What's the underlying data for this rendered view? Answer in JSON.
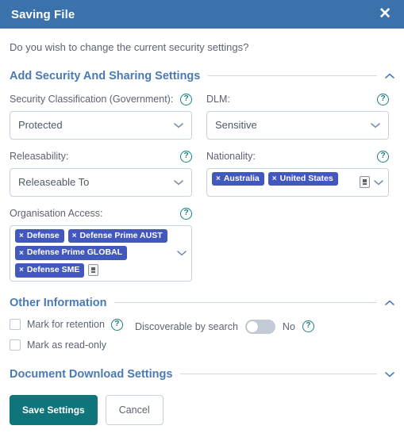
{
  "window": {
    "title": "Saving File",
    "close_icon": "close-icon"
  },
  "prompt": "Do you wish to change the current security settings?",
  "sections": {
    "security": {
      "title": "Add Security And Sharing Settings",
      "collapse_state": "expanded"
    },
    "other": {
      "title": "Other Information",
      "collapse_state": "expanded"
    },
    "download": {
      "title": "Document Download Settings",
      "collapse_state": "collapsed"
    }
  },
  "fields": {
    "security_classification": {
      "label": "Security Classification (Government):",
      "value": "Protected",
      "help": "?"
    },
    "dlm": {
      "label": "DLM:",
      "value": "Sensitive",
      "help": "?"
    },
    "releasability": {
      "label": "Releasability:",
      "value": "Releaseable To",
      "help": "?"
    },
    "nationality": {
      "label": "Nationality:",
      "help": "?",
      "tags": [
        "Australia",
        "United States"
      ],
      "remove_glyph": "×"
    },
    "organisation_access": {
      "label": "Organisation Access:",
      "help": "?",
      "tags": [
        "Defense",
        "Defense Prime AUST",
        "Defense Prime GLOBAL",
        "Defense SME"
      ],
      "remove_glyph": "×"
    }
  },
  "other_information": {
    "mark_for_retention": {
      "label": "Mark for retention",
      "checked": false,
      "help": "?"
    },
    "mark_as_read_only": {
      "label": "Mark as read-only",
      "checked": false
    },
    "discoverable_by_search": {
      "label": "Discoverable by search",
      "state": "No",
      "checked": false,
      "help": "?"
    }
  },
  "buttons": {
    "save": "Save Settings",
    "cancel": "Cancel"
  },
  "colors": {
    "titlebar": "#3c72ab",
    "section_title": "#4a7ab5",
    "chip": "#4258bd",
    "help_icon": "#1c7d7d",
    "primary_button": "#0f757a",
    "label_text": "#5a6472",
    "border": "#c6d2e0"
  }
}
